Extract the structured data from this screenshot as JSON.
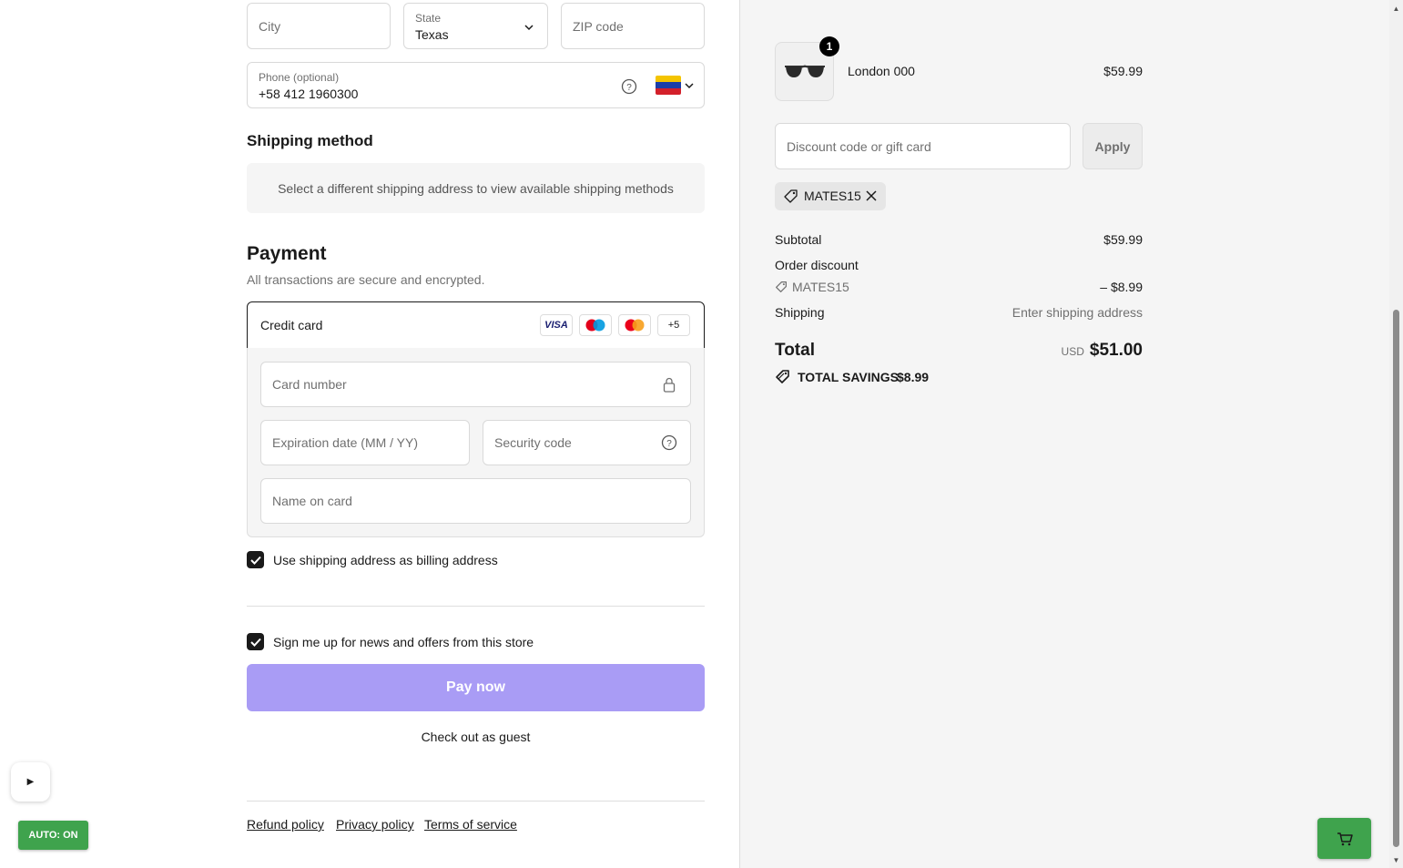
{
  "address": {
    "city_placeholder": "City",
    "state_label": "State",
    "state_value": "Texas",
    "zip_placeholder": "ZIP code",
    "phone_label": "Phone (optional)",
    "phone_value": "+58 412 1960300",
    "phone_country_flag": "venezuela-flag-icon"
  },
  "shipping": {
    "title": "Shipping method",
    "message": "Select a different shipping address to view available shipping methods"
  },
  "payment": {
    "title": "Payment",
    "subtitle": "All transactions are secure and encrypted.",
    "method_label": "Credit card",
    "card_logos": [
      "VISA",
      "Maestro",
      "Mastercard"
    ],
    "more_cards": "+5",
    "card_number_placeholder": "Card number",
    "expiry_placeholder": "Expiration date (MM / YY)",
    "security_placeholder": "Security code",
    "name_placeholder": "Name on card",
    "billing_checkbox_label": "Use shipping address as billing address",
    "billing_checked": true
  },
  "newsletter": {
    "label": "Sign me up for news and offers from this store",
    "checked": true
  },
  "actions": {
    "pay_now": "Pay now",
    "guest": "Check out as guest"
  },
  "footer": {
    "links": [
      "Refund policy",
      "Privacy policy",
      "Terms of service"
    ]
  },
  "overlay": {
    "play_label": "▶",
    "auto_label": "AUTO: ON"
  },
  "summary": {
    "item": {
      "name": "London 000",
      "price": "$59.99",
      "quantity": "1",
      "image_icon": "sunglasses-icon"
    },
    "discount_placeholder": "Discount code or gift card",
    "apply_label": "Apply",
    "applied_code": "MATES15",
    "subtotal_label": "Subtotal",
    "subtotal_value": "$59.99",
    "order_discount_label": "Order discount",
    "order_discount_code": "MATES15",
    "order_discount_value": "– $8.99",
    "shipping_label": "Shipping",
    "shipping_value": "Enter shipping address",
    "total_label": "Total",
    "currency": "USD",
    "total_value": "$51.00",
    "savings_label": "TOTAL SAVINGS",
    "savings_value": "$8.99"
  },
  "colors": {
    "pay_button": "#a99cf5",
    "auto_green": "#3fa34d",
    "summary_bg": "#f5f5f5"
  }
}
